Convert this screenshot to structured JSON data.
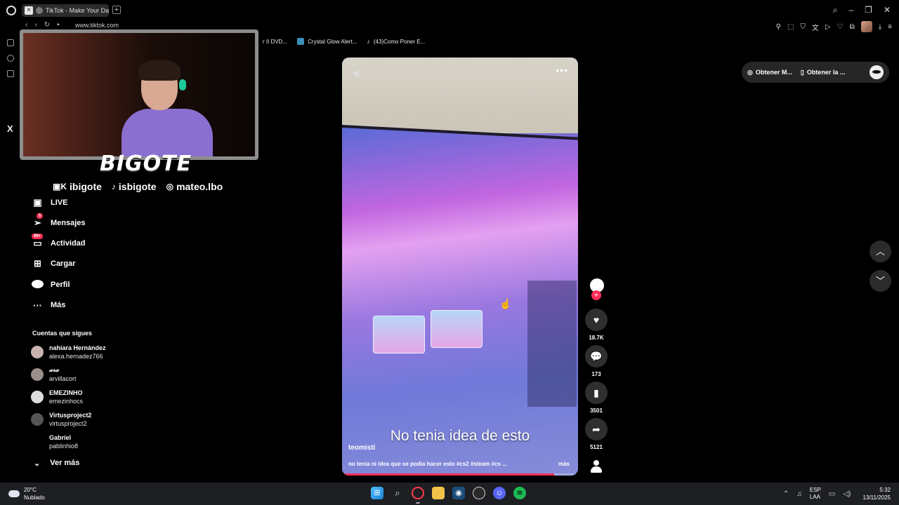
{
  "browser": {
    "tab_title": "TikTok - Make Your Da",
    "url": "www.tiktok.com",
    "bookmarks": [
      {
        "label": "r II DVD...",
        "icon": "none"
      },
      {
        "label": "Crystal Glow Alert...",
        "icon": "bookmark-icon"
      },
      {
        "label": "(43)Como Poner E...",
        "icon": "tiktok-icon"
      }
    ],
    "rail_extra": {
      "gx": "GX",
      "more": "..."
    }
  },
  "overlay": {
    "brand": "BIGOTE",
    "socials": [
      {
        "icon": "twitch-kick-icon",
        "handle": "ibigote"
      },
      {
        "icon": "tiktok-icon",
        "handle": "isbigote"
      },
      {
        "icon": "instagram-icon",
        "handle": "mateo.lbo"
      }
    ]
  },
  "sidebar": {
    "nav": [
      {
        "id": "live",
        "label": "LIVE",
        "icon": "live-icon",
        "badge": ""
      },
      {
        "id": "mensajes",
        "label": "Mensajes",
        "icon": "send-icon",
        "badge": "5"
      },
      {
        "id": "actividad",
        "label": "Actividad",
        "icon": "activity-icon",
        "badge": "99+"
      },
      {
        "id": "cargar",
        "label": "Cargar",
        "icon": "upload-icon",
        "badge": ""
      },
      {
        "id": "perfil",
        "label": "Perfil",
        "icon": "profile-icon",
        "badge": ""
      },
      {
        "id": "mas",
        "label": "Más",
        "icon": "more-icon",
        "badge": ""
      }
    ],
    "following_title": "Cuentas que sigues",
    "accounts": [
      {
        "name": "nahiara Hernández",
        "user": "alexa.hernadez766"
      },
      {
        "name": "𝒶𝓇𝒶",
        "user": "arvillacort"
      },
      {
        "name": "EMEZINHO",
        "user": "emezinhocs"
      },
      {
        "name": "Virtusproject2",
        "user": "virtusproject2"
      },
      {
        "name": "Gabriel",
        "user": "pablinhio8"
      }
    ],
    "see_more": "Ver más"
  },
  "video": {
    "caption": "No tenia idea de esto",
    "author": "teomisti",
    "description": "no tenia ni idea que se podia hacer esto #cs2 #steam #cs ...",
    "more_label": "más",
    "progress": 0.9
  },
  "actions": {
    "likes": "18.7K",
    "comments": "173",
    "saves": "3501",
    "shares": "5121"
  },
  "right_bar": {
    "get_pc": "Obtener M...",
    "get_app": "Obtener la ..."
  },
  "taskbar": {
    "temperature": "20°C",
    "weather": "Nublado",
    "lang1": "ESP",
    "lang2": "LAA",
    "time": "5:32",
    "date": "13/11/2025"
  },
  "colors": {
    "accent": "#fe2c55",
    "background": "#000000",
    "button_bg": "#2f2f2f"
  }
}
